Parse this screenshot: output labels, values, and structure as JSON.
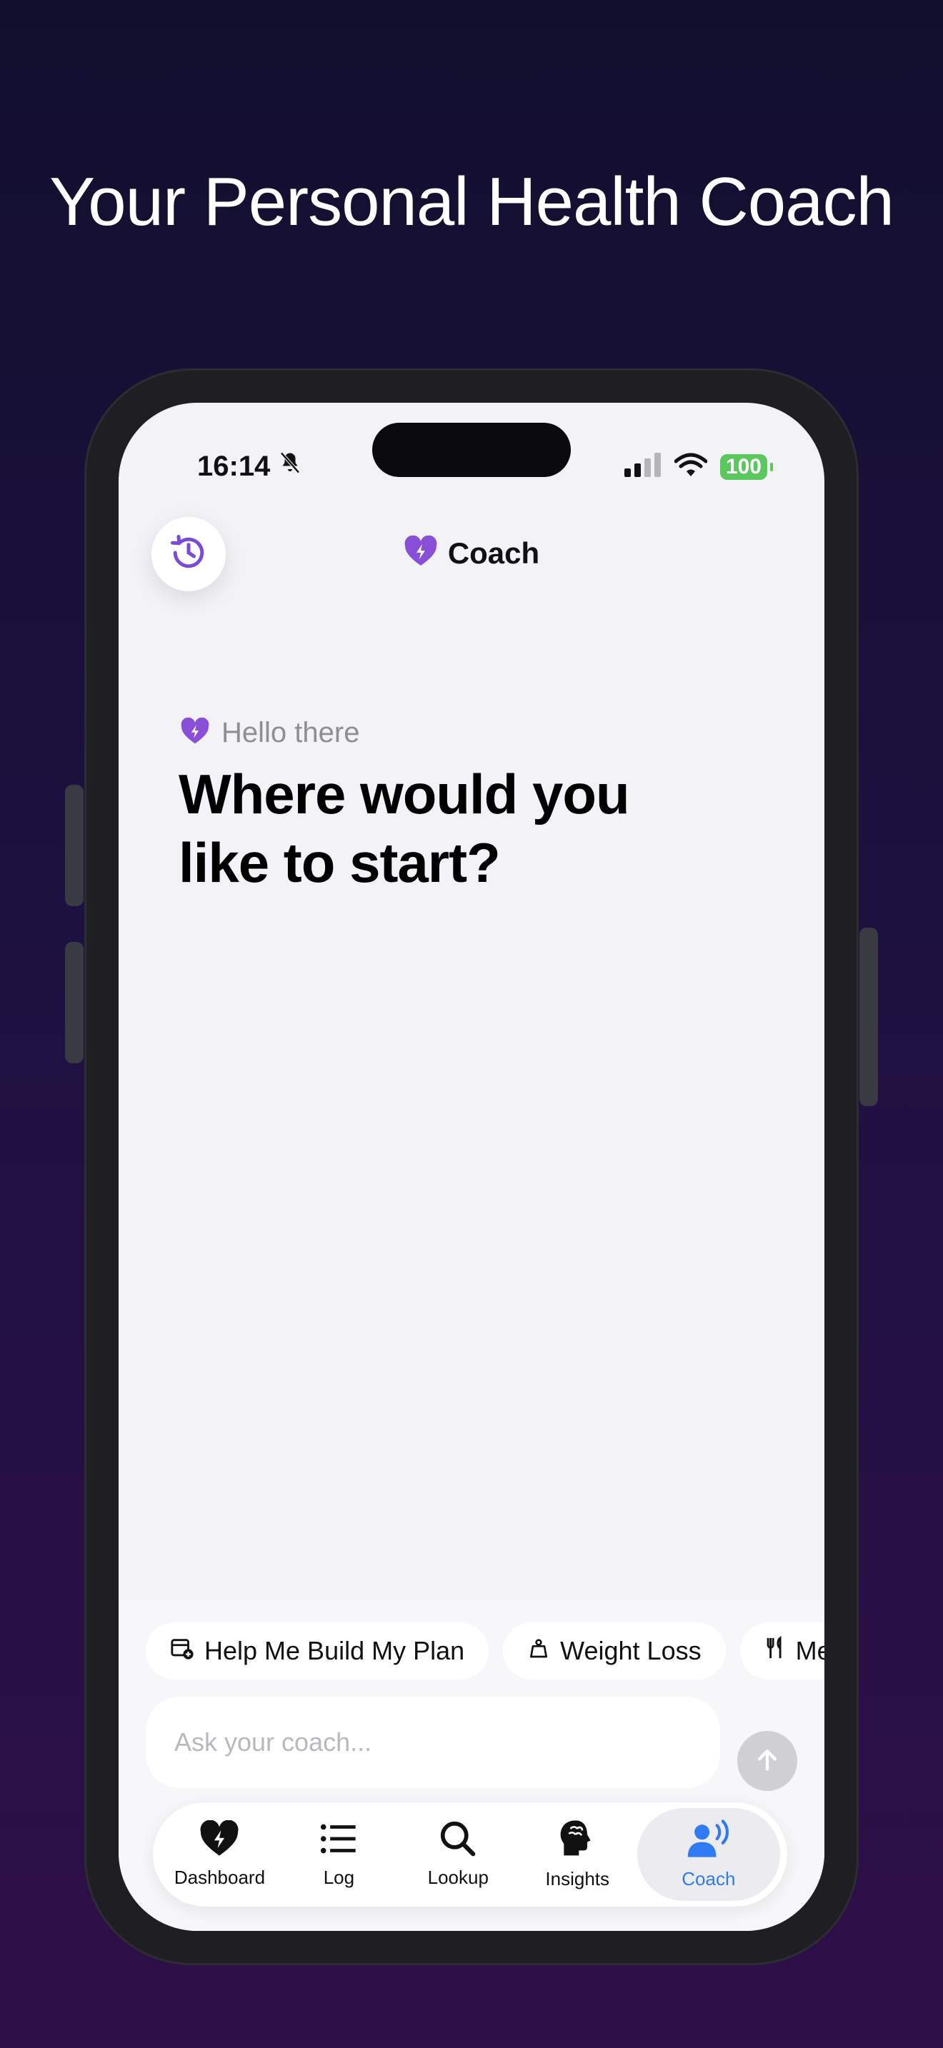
{
  "headline": "Your Personal Health Coach",
  "status_bar": {
    "time": "16:14",
    "battery": "100",
    "icons": [
      "bell-slash-icon",
      "cellular-signal-icon",
      "wifi-icon",
      "battery-icon"
    ]
  },
  "nav": {
    "title": "Coach",
    "history_icon": "history-icon",
    "title_icon": "heart-bolt-icon"
  },
  "greeting": {
    "subtitle": "Hello there",
    "question": "Where would you like to start?"
  },
  "chips": [
    {
      "label": "Help Me Build My Plan",
      "icon": "calendar-plus-icon"
    },
    {
      "label": "Weight Loss",
      "icon": "weight-icon"
    },
    {
      "label": "Me",
      "icon": "fork-knife-icon"
    }
  ],
  "composer": {
    "placeholder": "Ask your coach...",
    "send_icon": "arrow-up-icon"
  },
  "tabs": [
    {
      "label": "Dashboard",
      "icon": "heart-bolt-icon",
      "active": false
    },
    {
      "label": "Log",
      "icon": "list-icon",
      "active": false
    },
    {
      "label": "Lookup",
      "icon": "magnifier-icon",
      "active": false
    },
    {
      "label": "Insights",
      "icon": "brain-head-icon",
      "active": false
    },
    {
      "label": "Coach",
      "icon": "coach-voice-icon",
      "active": true
    }
  ],
  "colors": {
    "accent_purple": "#8a4fd8",
    "active_tab_blue": "#2f7bf5",
    "battery_green": "#5ac75f"
  }
}
